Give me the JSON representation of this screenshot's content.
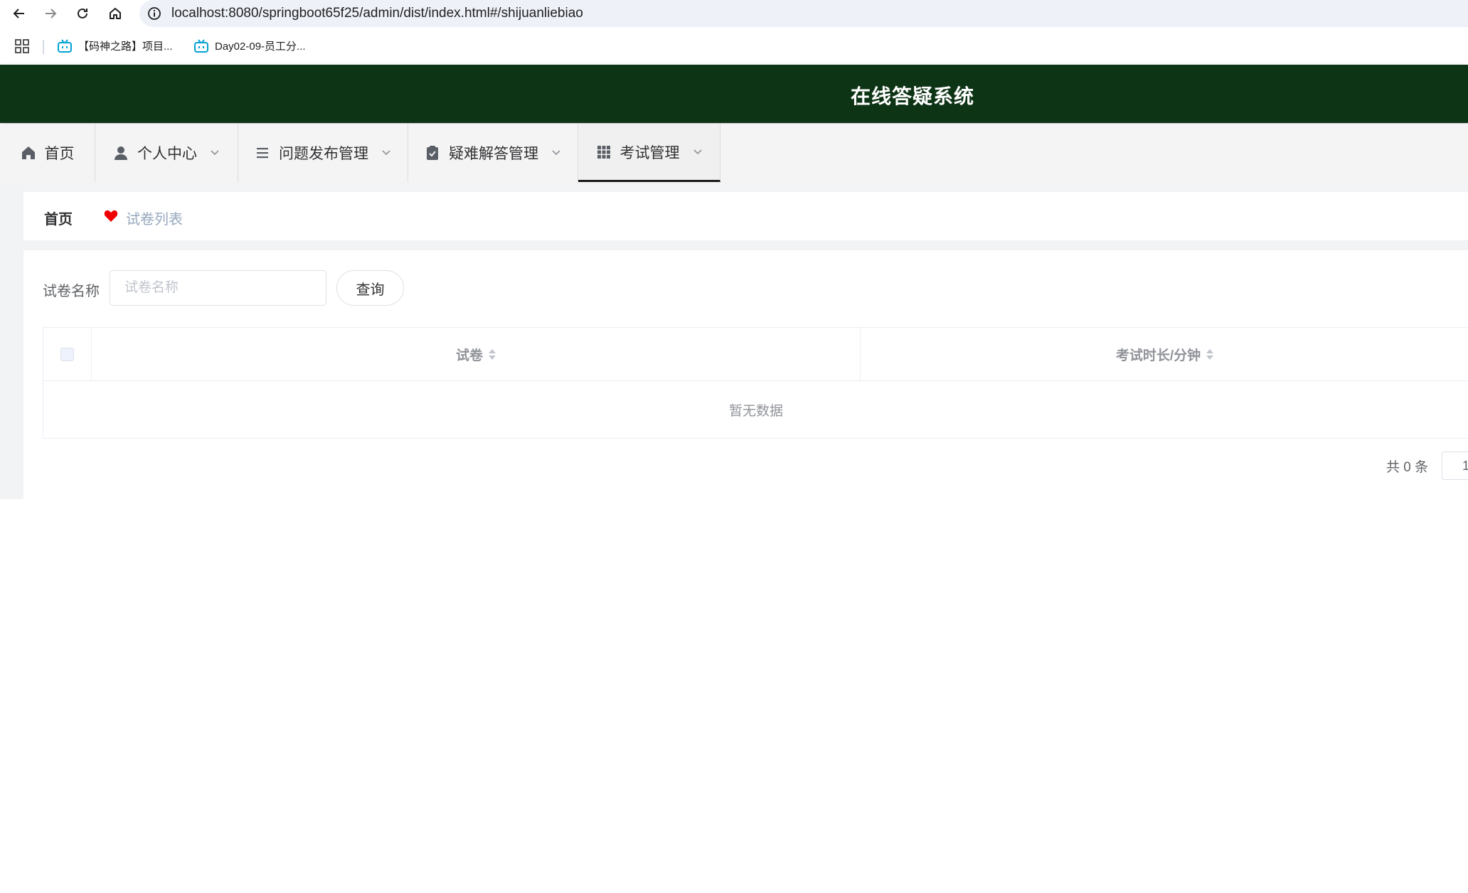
{
  "browser": {
    "url": "localhost:8080/springboot65f25/admin/dist/index.html#/shijuanliebiao",
    "bookmarks": [
      {
        "label": "【码神之路】项目..."
      },
      {
        "label": "Day02-09-员工分..."
      }
    ]
  },
  "app": {
    "title": "在线答疑系统"
  },
  "menu": {
    "items": [
      {
        "label": "首页"
      },
      {
        "label": "个人中心"
      },
      {
        "label": "问题发布管理"
      },
      {
        "label": "疑难解答管理"
      },
      {
        "label": "考试管理"
      }
    ]
  },
  "breadcrumb": {
    "home": "首页",
    "current": "试卷列表"
  },
  "search": {
    "label": "试卷名称",
    "placeholder": "试卷名称",
    "button": "查询"
  },
  "table": {
    "columns": [
      "试卷",
      "考试时长/分钟"
    ],
    "empty_text": "暂无数据"
  },
  "pagination": {
    "total_text": "共 0 条",
    "page_value": "1"
  },
  "colors": {
    "header_bg": "#0e3416",
    "heart": "#f00000"
  }
}
